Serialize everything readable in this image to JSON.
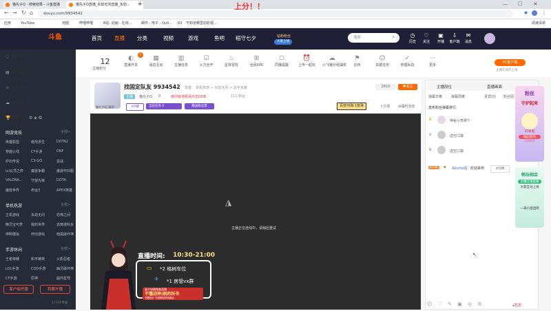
{
  "browser": {
    "tabs": [
      {
        "label": "猫先子Q - 搜索结果 - 斗鱼直播"
      },
      {
        "label": "猫先子Q直播_永劫无间直播_永劫..."
      },
      {
        "label": ""
      }
    ],
    "new_tab": "+",
    "url": "douyu.com/9934542",
    "bookmarks": [
      "应用",
      "YouTube",
      "地图",
      "哔哩哔哩",
      "B站: 动画 - 在线...",
      "邮件 - 电子 - Outl...",
      "R2",
      "不知道哪里的影视...",
      "阅读清单"
    ]
  },
  "site": {
    "logo": "斗鱼",
    "nav": [
      "首页",
      "直播",
      "分类",
      "视频",
      "游戏",
      "鱼吧",
      "稻守七夕"
    ],
    "nav_active": "直播",
    "promo_top": "钻粉粉丝",
    "promo_bottom": "大策上线",
    "search_placeholder": "搜索",
    "header_icons": [
      {
        "label": "历史",
        "icon": "clock-icon"
      },
      {
        "label": "关注",
        "icon": "heart-icon"
      },
      {
        "label": "开播",
        "icon": "broadcast-icon"
      },
      {
        "label": "客户端",
        "icon": "download-icon"
      },
      {
        "label": "消息",
        "icon": "mail-icon"
      }
    ]
  },
  "sidebar": {
    "top_items": [
      {
        "label": "我的关注",
        "icon": "heart-icon"
      },
      {
        "label": "排行榜",
        "icon": "rank-icon"
      },
      {
        "label": "元旦中心",
        "icon": "star-icon"
      },
      {
        "label": "云游戏",
        "icon": "cloud-icon"
      }
    ],
    "row_icons_label": "赛事",
    "section1": {
      "title": "网游竞技",
      "more": "全部>",
      "cells": [
        "英雄联盟",
        "绝地求生",
        "DOTA2",
        "穿越火线",
        "CF手游",
        "DNF",
        "炉石传说",
        "CS:GO",
        "逆战",
        "lol云顶之弈",
        "魔兽争霸",
        "魔兽怀旧服",
        "VALORA...",
        "守望先锋",
        "DOTA",
        "魔兽世界",
        "命运3",
        "APEX英雄"
      ]
    },
    "section2": {
      "title": "单机热游",
      "more": "全部>",
      "cells": [
        "主机游戏",
        "永劫无间",
        "恐怖之间",
        "精灵宝可梦",
        "我的世界",
        "逃离塔科夫",
        "神明模拟",
        "怀旧游戏",
        "暗黑破坏神"
      ]
    },
    "section3": {
      "title": "手游休闲",
      "more": "全部>",
      "cells": [
        "王者荣耀",
        "和平精英",
        "火影忍者",
        "LOL手游",
        "COD手游",
        "幽灵破坏神",
        "CF手游",
        "原神",
        "崩坏星穹"
      ]
    },
    "btn_client": "客户端开播",
    "btn_start": "我要开播",
    "footer": "12345举报"
  },
  "categories": {
    "level_num": "12",
    "level_label": "主播积分",
    "badge_count": "7",
    "items": [
      "直播开关",
      "消息互动",
      "主播任务",
      "火力全开",
      "星体冒险",
      "全民KPK",
      "同播提醒",
      "上传一起玩",
      "小飞猪分组抽奖",
      "云桥",
      "关键任务",
      "管理私信",
      "更多"
    ],
    "pc_btn": "PC客户端",
    "pc_sub": "主播在线开上线"
  },
  "room": {
    "title": "找固定队友 9934542",
    "tag_label": "举报",
    "category": "单机热游 > 永劫无间 > 选手未播",
    "streamer": "猫先子Q",
    "stats": "0",
    "warning": "房间有违规请点击DDB",
    "heat": "111.8kg",
    "btn_vip": "VIP播",
    "btn_task": "当前任务",
    "btn_task_n": "0",
    "btn_gift": "赠送粉丝票",
    "rank_num": "2810",
    "follow": "关注",
    "rank_badge": "百度何弹:1度弹",
    "share": "分享",
    "report": "福利活动",
    "offline_label": "猫先子Q已离开"
  },
  "video": {
    "offline_msg": "主播正在连线中，请稍后重试",
    "schedule_title": "直播时间:",
    "schedule_time": "10:30-21:00",
    "line1_icon": "*2",
    "line1": "格树车位",
    "line2_icon": "*1",
    "line2": "房管vx群",
    "banner_top": "真不如赖看着直播",
    "banner_main": "不懂战神|刷药科书",
    "banner_sub": "书籍设计 书游鹅战场有趣点"
  },
  "right": {
    "tabs": [
      "主播段位",
      "直播画面"
    ],
    "subtabs": [
      "弹幕日推",
      "弹幕周推",
      "贵宾(0)",
      "粉丝团"
    ],
    "notice": "发布粉丝弹幕排行",
    "rank": [
      {
        "name": "神秘小乖那个",
        "badge": "1"
      },
      {
        "name": "虚空口袋",
        "badge": "2"
      },
      {
        "name": "虚空口袋",
        "badge": "3"
      }
    ],
    "chat_level": "LV.36",
    "chat_user": "Akuma怕",
    "chat_text": "欢迎来到",
    "chat_btn": "切换",
    "send_btn": "发送"
  },
  "ad": {
    "title_top": "粉丝",
    "title_mid": "守护起来",
    "sub1": "25折起",
    "sub2": "抽出星光",
    "sub3": "1000元",
    "card2_title": "畅玩相会",
    "card2_sub": "主播在线直播",
    "card2_sub2": "大家互动上线",
    "card2_foot": "一来小团团吧"
  }
}
